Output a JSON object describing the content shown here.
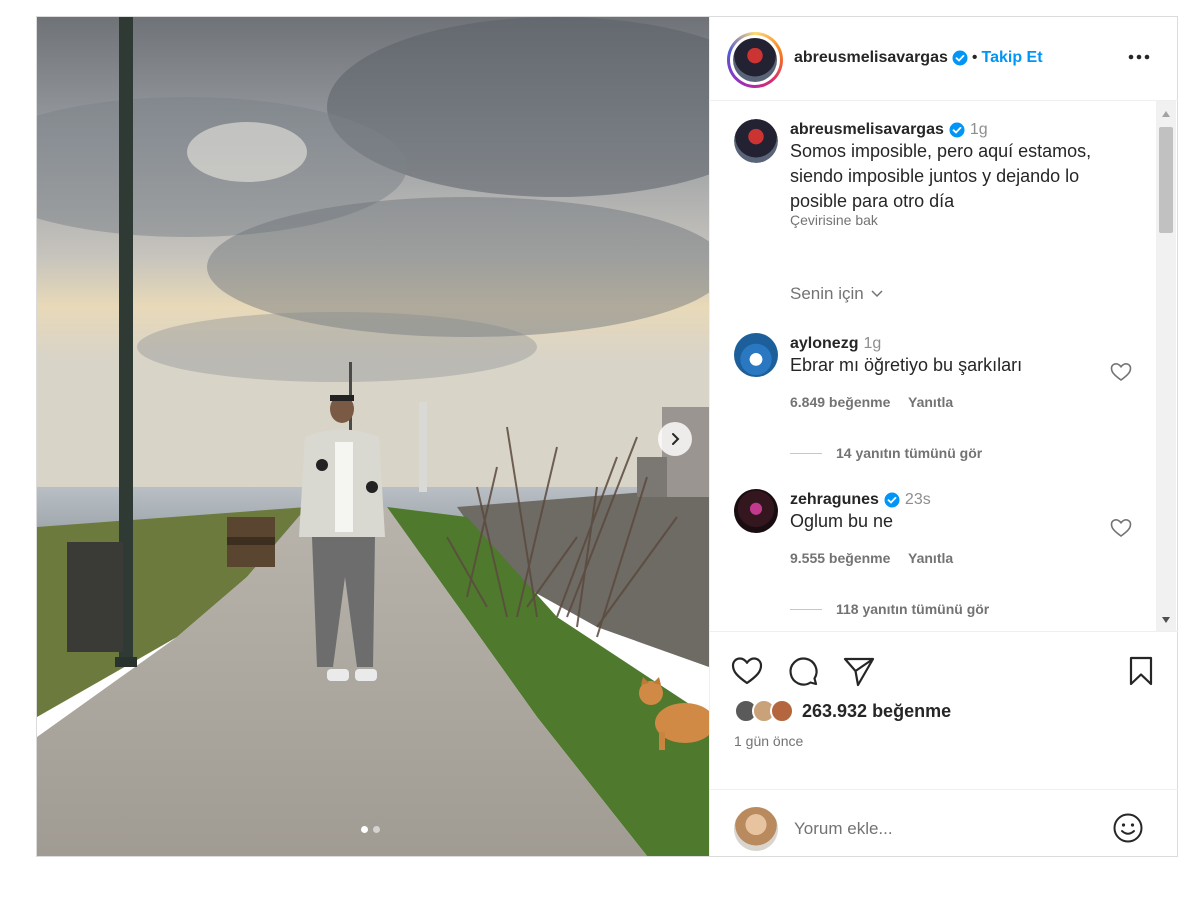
{
  "post": {
    "username": "abreusmelisavargas",
    "separator": "•",
    "follow_label": "Takip Et",
    "more_label": "•••"
  },
  "caption": {
    "username": "abreusmelisavargas",
    "time": "1g",
    "text_line1": "Somos imposible, pero aquí estamos,",
    "text_line2": "siendo imposible juntos y dejando lo",
    "text_line3": "posible para otro día",
    "translate_label": "Çevirisine bak"
  },
  "sort": {
    "label": "Senin için"
  },
  "comments": [
    {
      "username": "aylonezg",
      "time": "1g",
      "text": "Ebrar mı öğretiyo bu şarkıları",
      "likes": "6.849 beğenme",
      "reply_label": "Yanıtla",
      "view_replies": "14 yanıtın tümünü gör",
      "verified": false
    },
    {
      "username": "zehragunes",
      "time": "23s",
      "text": "Oglum bu ne",
      "likes": "9.555 beğenme",
      "reply_label": "Yanıtla",
      "view_replies": "118 yanıtın tümünü gör",
      "verified": true
    }
  ],
  "footer": {
    "likes": "263.932 beğenme",
    "posted_ago": "1 gün önce",
    "comment_placeholder": "Yorum ekle..."
  },
  "carousel": {
    "current": 1,
    "total": 2
  },
  "icons": {
    "like": "heart-icon",
    "comment": "comment-icon",
    "share": "send-icon",
    "save": "bookmark-icon",
    "emoji": "emoji-icon",
    "next": "chevron-right-icon",
    "verified": "verified-badge-icon"
  },
  "colors": {
    "follow": "#0095f6",
    "verified": "#0095f6",
    "text": "#262626",
    "muted": "#737373"
  }
}
